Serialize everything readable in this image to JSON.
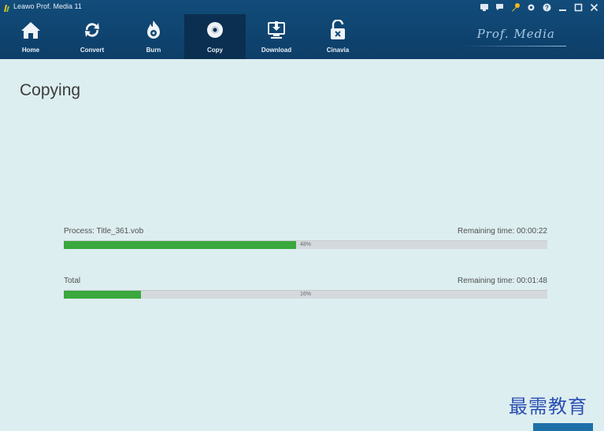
{
  "window": {
    "title": "Leawo Prof. Media 11"
  },
  "nav": {
    "items": [
      {
        "label": "Home",
        "icon": "home-icon"
      },
      {
        "label": "Convert",
        "icon": "convert-icon"
      },
      {
        "label": "Burn",
        "icon": "burn-icon"
      },
      {
        "label": "Copy",
        "icon": "disc-icon"
      },
      {
        "label": "Download",
        "icon": "download-icon"
      },
      {
        "label": "Cinavia",
        "icon": "unlock-icon"
      }
    ],
    "active": "Copy"
  },
  "brand": "Prof. Media",
  "main": {
    "title": "Copying",
    "process": {
      "label": "Process: Title_361.vob",
      "remaining": "Remaining time: 00:00:22",
      "percent_text": "48%",
      "progress": 0.48
    },
    "total": {
      "label": "Total",
      "remaining": "Remaining time: 00:01:48",
      "percent_text": "16%",
      "progress": 0.16
    }
  },
  "watermark": "最需教育",
  "colors": {
    "header": "#124c7a",
    "active_tab": "#0a2f50",
    "content_bg": "#ddeef0",
    "progress_fill": "#3aa83d",
    "progress_track": "#d3d9dc"
  }
}
